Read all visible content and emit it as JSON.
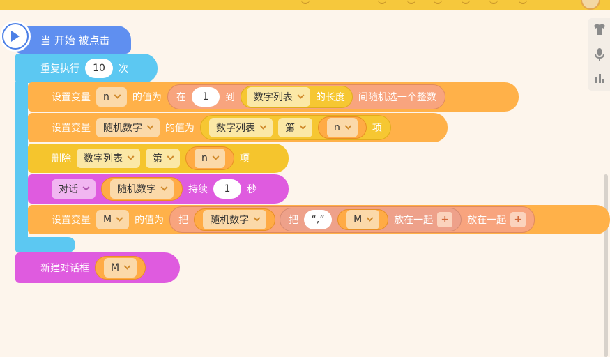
{
  "script": {
    "hat_label": "当 开始 被点击",
    "repeat": {
      "label_prefix": "重复执行",
      "count": "10",
      "label_suffix": "次"
    },
    "set1": {
      "prefix": "设置变量",
      "var": "n",
      "value_label": "的值为",
      "rand_from": "在",
      "rand_min": "1",
      "rand_to": "到",
      "list": "数字列表",
      "length_label": "的长度",
      "rand_suffix": "间随机选一个整数"
    },
    "set2": {
      "prefix": "设置变量",
      "var": "随机数字",
      "value_label": "的值为",
      "list": "数字列表",
      "item_label": "第",
      "index_var": "n",
      "item_suffix": "项"
    },
    "delete": {
      "prefix": "删除",
      "list": "数字列表",
      "item_label": "第",
      "index_var": "n",
      "item_suffix": "项"
    },
    "say": {
      "mode": "对话",
      "var": "随机数字",
      "duration_label": "持续",
      "seconds": "1",
      "unit": "秒"
    },
    "set3": {
      "prefix": "设置变量",
      "var": "M",
      "value_label": "的值为",
      "join_label": "把",
      "join_var": "随机数字",
      "join2_label": "把",
      "join2_text": "“,”",
      "join2_var": "M",
      "join_together": "放在一起",
      "join_together_outer": "放在一起",
      "plus": "+"
    },
    "new_dialog": {
      "label": "新建对话框",
      "var": "M"
    }
  },
  "tools": {
    "costume_icon": "shirt-icon",
    "sound_icon": "microphone-icon",
    "chart_icon": "bar-chart-icon"
  }
}
